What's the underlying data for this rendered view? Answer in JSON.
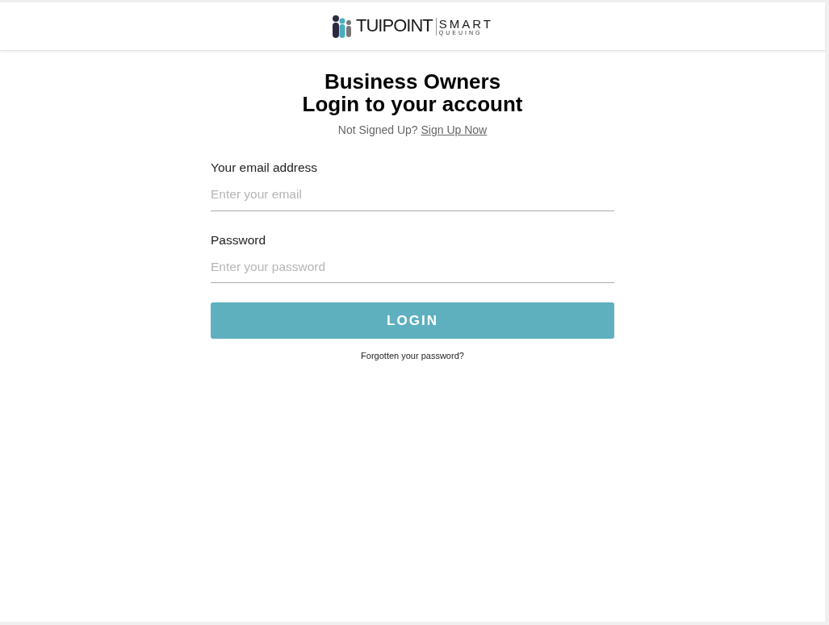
{
  "header": {
    "logo": {
      "name": "TUIPOINT",
      "tagline_top": "SMART",
      "tagline_bottom": "QUEUING"
    }
  },
  "heading": [
    "Business Owners",
    "Login to your account"
  ],
  "signup": {
    "prompt": "Not Signed Up?",
    "link": "Sign Up Now"
  },
  "fields": [
    {
      "label": "Your email address",
      "placeholder": "Enter your email"
    },
    {
      "label": "Password",
      "placeholder": "Enter your password"
    }
  ],
  "login_button": "LOGIN",
  "forgot_link": "Forgotten your password?"
}
